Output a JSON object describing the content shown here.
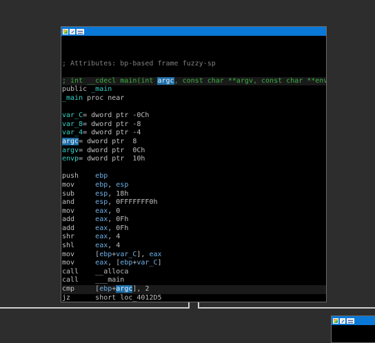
{
  "node_main": {
    "lines": [
      {
        "t": "empty"
      },
      {
        "t": "comment",
        "text": "; Attributes: bp-based frame fuzzy-sp"
      },
      {
        "t": "empty"
      },
      {
        "t": "proto",
        "pre": "; int __cdecl main(int ",
        "hl": "argc",
        "post": ", const char **argv, const char **envp)"
      },
      {
        "t": "plain",
        "a": "public ",
        "b": "_main"
      },
      {
        "t": "plain",
        "a": "_main",
        " b": "",
        "b": " proc near"
      },
      {
        "t": "empty"
      },
      {
        "t": "var",
        "name": "var_C",
        "rest": "= dword ptr -0Ch"
      },
      {
        "t": "var",
        "name": "var_8",
        "rest": "= dword ptr -8"
      },
      {
        "t": "var",
        "name": "var_4",
        "rest": "= dword ptr -4"
      },
      {
        "t": "var",
        "name": "argc",
        "rest": "= dword ptr  8",
        "sel": true
      },
      {
        "t": "var",
        "name": "argv",
        "rest": "= dword ptr  0Ch"
      },
      {
        "t": "var",
        "name": "envp",
        "rest": "= dword ptr  10h"
      },
      {
        "t": "empty"
      },
      {
        "t": "ins",
        "m": "push",
        "ops": [
          {
            "c": "reg",
            "v": "ebp"
          }
        ]
      },
      {
        "t": "ins",
        "m": "mov",
        "ops": [
          {
            "c": "reg",
            "v": "ebp"
          },
          {
            "c": "txt",
            "v": ", "
          },
          {
            "c": "reg",
            "v": "esp"
          }
        ]
      },
      {
        "t": "ins",
        "m": "sub",
        "ops": [
          {
            "c": "reg",
            "v": "esp"
          },
          {
            "c": "txt",
            "v": ", 18h"
          }
        ]
      },
      {
        "t": "ins",
        "m": "and",
        "ops": [
          {
            "c": "reg",
            "v": "esp"
          },
          {
            "c": "txt",
            "v": ", 0FFFFFFF0h"
          }
        ]
      },
      {
        "t": "ins",
        "m": "mov",
        "ops": [
          {
            "c": "reg",
            "v": "eax"
          },
          {
            "c": "txt",
            "v": ", 0"
          }
        ]
      },
      {
        "t": "ins",
        "m": "add",
        "ops": [
          {
            "c": "reg",
            "v": "eax"
          },
          {
            "c": "txt",
            "v": ", 0Fh"
          }
        ]
      },
      {
        "t": "ins",
        "m": "add",
        "ops": [
          {
            "c": "reg",
            "v": "eax"
          },
          {
            "c": "txt",
            "v": ", 0Fh"
          }
        ]
      },
      {
        "t": "ins",
        "m": "shr",
        "ops": [
          {
            "c": "reg",
            "v": "eax"
          },
          {
            "c": "txt",
            "v": ", 4"
          }
        ]
      },
      {
        "t": "ins",
        "m": "shl",
        "ops": [
          {
            "c": "reg",
            "v": "eax"
          },
          {
            "c": "txt",
            "v": ", 4"
          }
        ]
      },
      {
        "t": "ins",
        "m": "mov",
        "ops": [
          {
            "c": "txt",
            "v": "["
          },
          {
            "c": "reg",
            "v": "ebp"
          },
          {
            "c": "txt",
            "v": "+"
          },
          {
            "c": "sym",
            "v": "var_C"
          },
          {
            "c": "txt",
            "v": "], "
          },
          {
            "c": "reg",
            "v": "eax"
          }
        ]
      },
      {
        "t": "ins",
        "m": "mov",
        "ops": [
          {
            "c": "reg",
            "v": "eax"
          },
          {
            "c": "txt",
            "v": ", ["
          },
          {
            "c": "reg",
            "v": "ebp"
          },
          {
            "c": "txt",
            "v": "+"
          },
          {
            "c": "sym",
            "v": "var_C"
          },
          {
            "c": "txt",
            "v": "]"
          }
        ]
      },
      {
        "t": "ins",
        "m": "call",
        "ops": [
          {
            "c": "txt",
            "v": "__alloca"
          }
        ]
      },
      {
        "t": "ins",
        "m": "call",
        "ops": [
          {
            "c": "txt",
            "v": "___main"
          }
        ]
      },
      {
        "t": "ins",
        "m": "cmp",
        "hl": true,
        "ops": [
          {
            "c": "txt",
            "v": "["
          },
          {
            "c": "reg",
            "v": "ebp"
          },
          {
            "c": "txt",
            "v": "+"
          },
          {
            "c": "sel",
            "v": "argc"
          },
          {
            "c": "txt",
            "v": "], 2"
          }
        ]
      },
      {
        "t": "ins",
        "m": "jz",
        "ops": [
          {
            "c": "txt",
            "v": "short "
          },
          {
            "c": "txt",
            "v": "loc_4012D5"
          }
        ]
      }
    ]
  }
}
